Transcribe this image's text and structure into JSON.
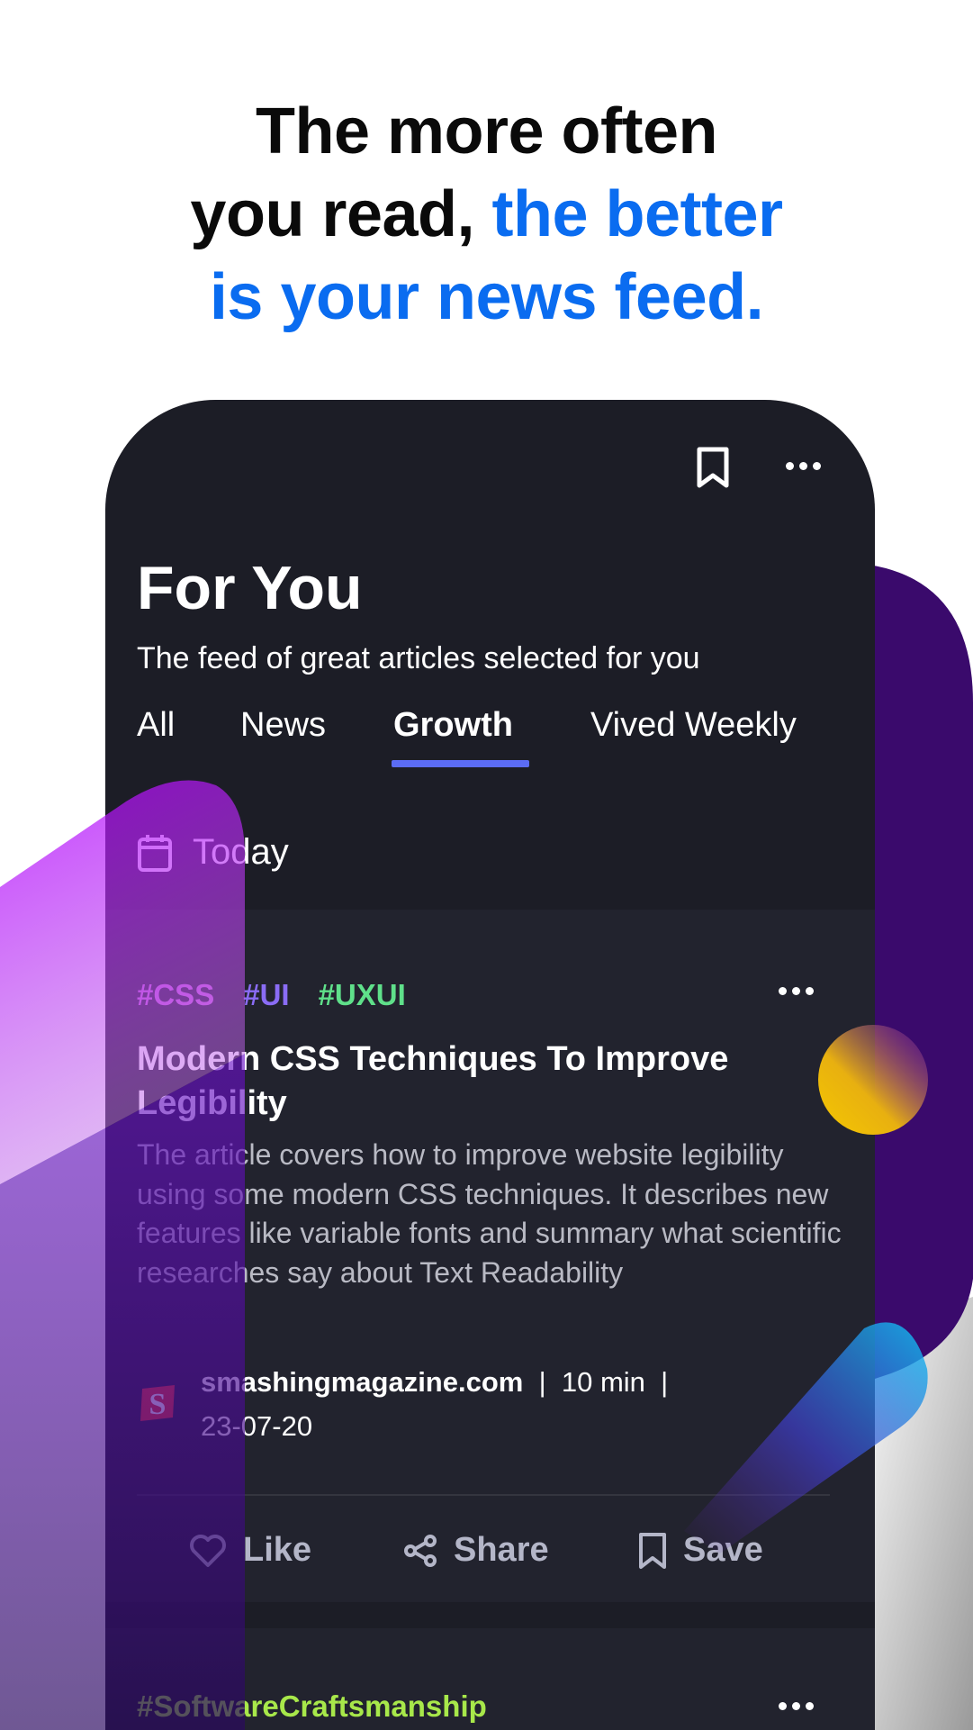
{
  "headline": {
    "line1": "The more often",
    "line2_plain": "you read, ",
    "line2_accent": "the better",
    "line3_accent": "is your news feed."
  },
  "colors": {
    "accent": "#0a6cf0",
    "tab_underline": "#5b6cf5",
    "tag_css": "#c86ad8",
    "tag_ui": "#8a6cf5",
    "tag_uxui": "#5fe08a",
    "tag_craft": "#a8e84a"
  },
  "app": {
    "top_icons": [
      "bookmark-icon",
      "more-icon"
    ],
    "title": "For You",
    "subtitle": "The feed of great articles selected for you",
    "tabs": [
      {
        "label": "All",
        "active": false
      },
      {
        "label": "News",
        "active": false
      },
      {
        "label": "Growth",
        "active": true
      },
      {
        "label": "Vived Weekly",
        "active": false
      }
    ],
    "section": {
      "icon": "calendar-icon",
      "label": "Today"
    },
    "articles": [
      {
        "tags": [
          "#CSS",
          "#UI",
          "#UXUI"
        ],
        "title": "Modern CSS Techniques To Improve Legibility",
        "body": "The article covers how to improve website legibility using some modern CSS techniques. It describes new features like variable fonts and summary what scientific researches say about Text Readability",
        "source": "smashingmagazine.com",
        "read_time": "10 min",
        "date": "23-07-20",
        "separator": "|",
        "actions": [
          {
            "icon": "heart-icon",
            "label": "Like"
          },
          {
            "icon": "share-icon",
            "label": "Share"
          },
          {
            "icon": "bookmark-icon",
            "label": "Save"
          }
        ]
      },
      {
        "tags": [
          "#SoftwareCraftsmanship"
        ]
      }
    ]
  }
}
